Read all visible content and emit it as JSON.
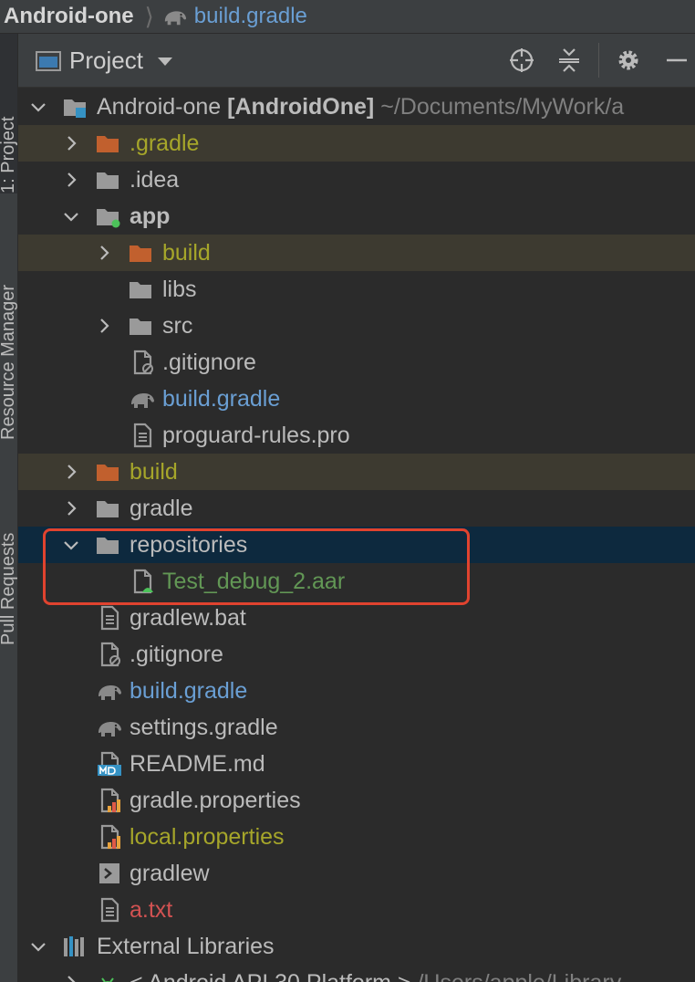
{
  "breadcrumb": {
    "project": "Android-one",
    "file": "build.gradle"
  },
  "side_tabs": [
    {
      "label": "1: Project"
    },
    {
      "label": "Resource Manager"
    },
    {
      "label": "Pull Requests"
    }
  ],
  "toolbar": {
    "view_mode": "Project"
  },
  "colors": {
    "selection": "#0d293e",
    "callout": "#e0432f",
    "excluded_bg": "#3d3a30"
  },
  "tree": {
    "root": {
      "name": "Android-one",
      "module": "[AndroidOne]",
      "path": "~/Documents/MyWork/a"
    },
    "gradle_dir": ".gradle",
    "idea_dir": ".idea",
    "app_dir": "app",
    "app_build": "build",
    "app_libs": "libs",
    "app_src": "src",
    "app_gitignore": ".gitignore",
    "app_build_gradle": "build.gradle",
    "app_proguard": "proguard-rules.pro",
    "build_dir": "build",
    "gradle_folder": "gradle",
    "repositories": "repositories",
    "aar_file": "Test_debug_2.aar",
    "gradlew_bat": "gradlew.bat",
    "gitignore": ".gitignore",
    "build_gradle": "build.gradle",
    "settings_gradle": "settings.gradle",
    "readme": "README.md",
    "gradle_properties": "gradle.properties",
    "local_properties": "local.properties",
    "gradlew": "gradlew",
    "a_txt": "a.txt",
    "external_libraries": "External Libraries",
    "android_platform": "< Android API 30 Platform >",
    "platform_path": "/Users/apple/Library"
  }
}
